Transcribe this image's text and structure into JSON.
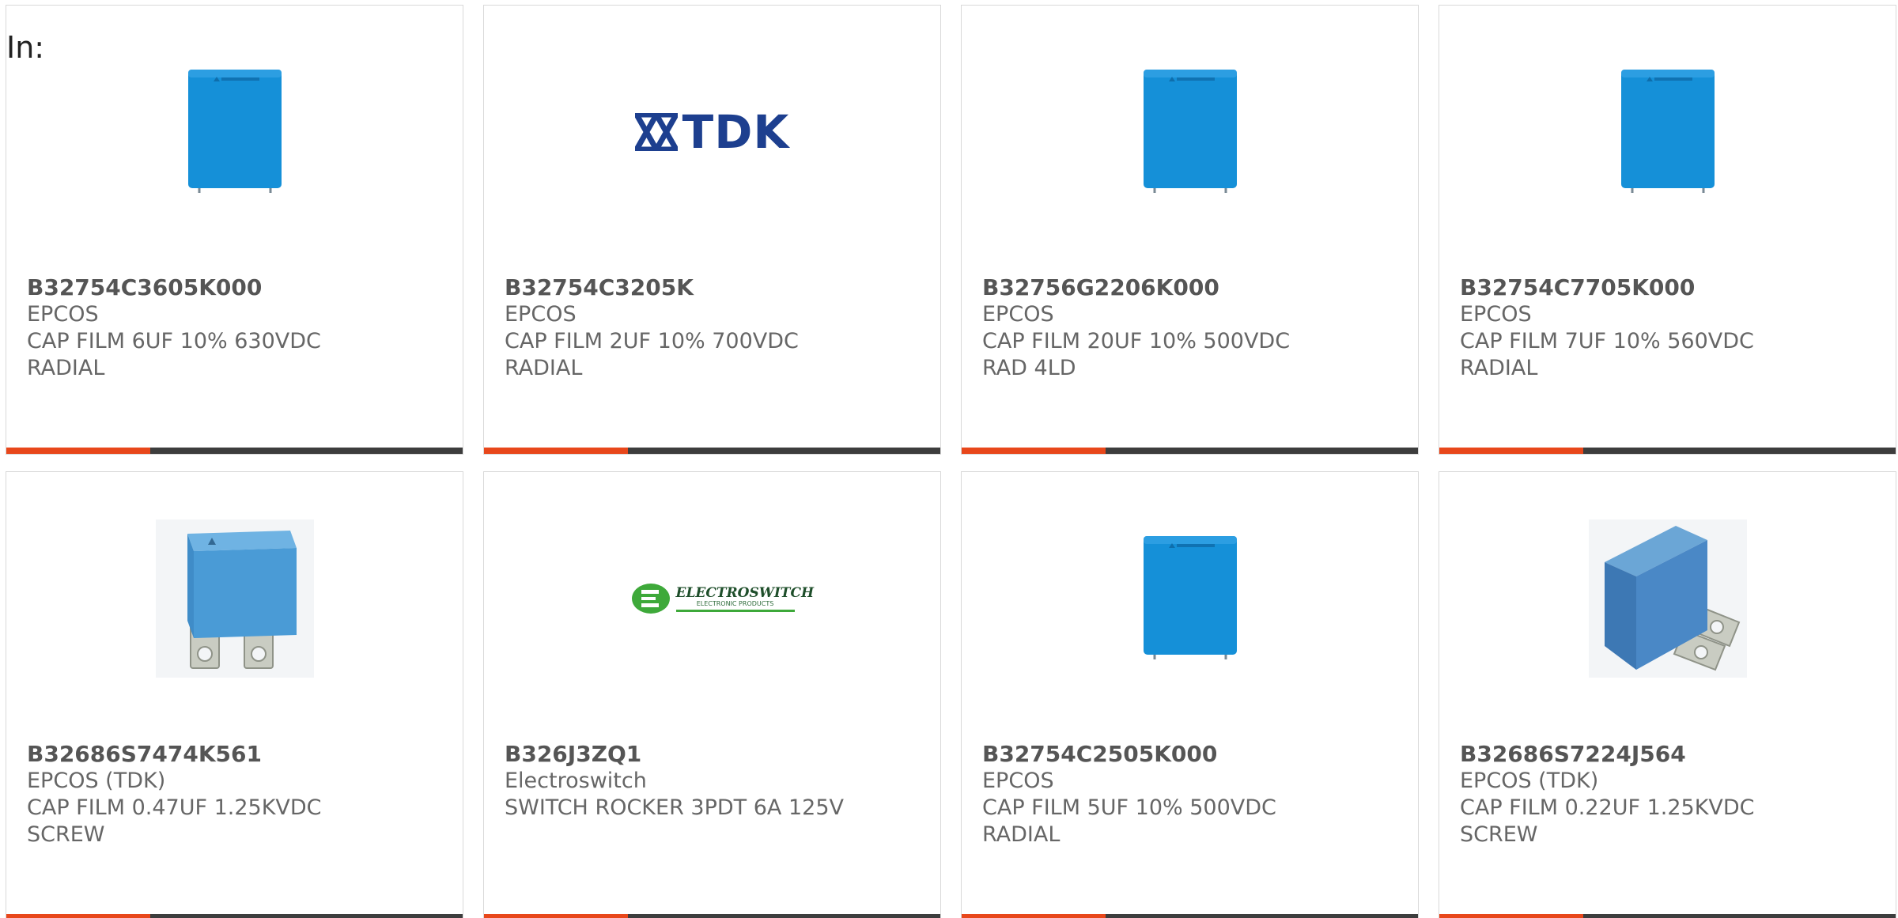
{
  "header": {
    "in_label": "In:"
  },
  "colors": {
    "accent_bar": "#e8471b",
    "dark_bar": "#3d3d3d",
    "capacitor_blue": "#1590d8",
    "tdk_navy": "#1d3f8f",
    "electroswitch_green": "#3ea93a"
  },
  "products": [
    {
      "part_number": "B32754C3605K000",
      "manufacturer": "EPCOS",
      "desc_line1": "CAP FILM 6UF 10% 630VDC",
      "desc_line2": "RADIAL",
      "image": "blue-box-capacitor"
    },
    {
      "part_number": "B32754C3205K",
      "manufacturer": "EPCOS",
      "desc_line1": "CAP FILM 2UF 10% 700VDC",
      "desc_line2": "RADIAL",
      "image": "tdk-logo",
      "logo_text": "TDK"
    },
    {
      "part_number": "B32756G2206K000",
      "manufacturer": "EPCOS",
      "desc_line1": "CAP FILM 20UF 10% 500VDC",
      "desc_line2": "RAD 4LD",
      "image": "blue-box-capacitor"
    },
    {
      "part_number": "B32754C7705K000",
      "manufacturer": "EPCOS",
      "desc_line1": "CAP FILM 7UF 10% 560VDC",
      "desc_line2": "RADIAL",
      "image": "blue-box-capacitor"
    },
    {
      "part_number": "B32686S7474K561",
      "manufacturer": "EPCOS (TDK)",
      "desc_line1": "CAP FILM 0.47UF 1.25KVDC",
      "desc_line2": "SCREW",
      "image": "screw-terminal-capacitor-front"
    },
    {
      "part_number": "B326J3ZQ1",
      "manufacturer": "Electroswitch",
      "desc_line1": "SWITCH ROCKER 3PDT 6A 125V",
      "desc_line2": "",
      "image": "electroswitch-logo",
      "logo_text": "ELECTROSWITCH",
      "logo_subtext": "ELECTRONIC PRODUCTS"
    },
    {
      "part_number": "B32754C2505K000",
      "manufacturer": "EPCOS",
      "desc_line1": "CAP FILM 5UF 10% 500VDC",
      "desc_line2": "RADIAL",
      "image": "blue-box-capacitor"
    },
    {
      "part_number": "B32686S7224J564",
      "manufacturer": "EPCOS (TDK)",
      "desc_line1": "CAP FILM 0.22UF 1.25KVDC",
      "desc_line2": "SCREW",
      "image": "screw-terminal-capacitor-angled"
    }
  ]
}
